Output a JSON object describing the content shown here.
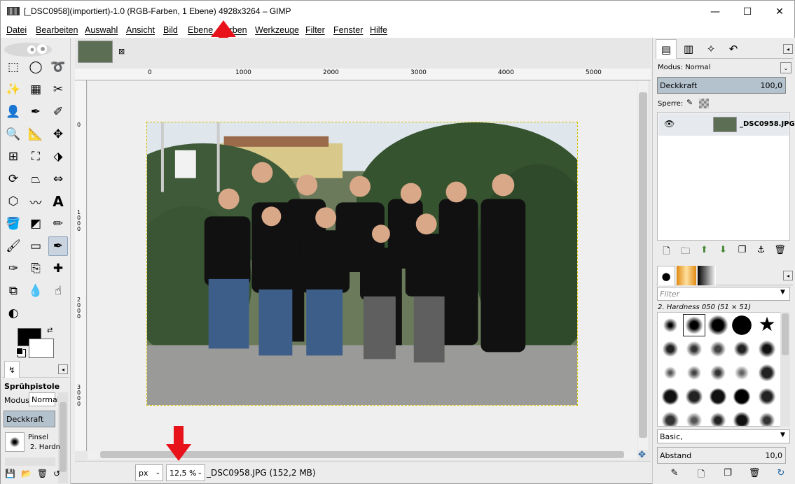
{
  "window": {
    "title": "[_DSC0958](importiert)-1.0 (RGB-Farben, 1 Ebene) 4928x3264 – GIMP",
    "minimize": "—",
    "maximize": "☐",
    "close": "✕"
  },
  "menu": [
    "Datei",
    "Bearbeiten",
    "Auswahl",
    "Ansicht",
    "Bild",
    "Ebene",
    "Farben",
    "Werkzeuge",
    "Filter",
    "Fenster",
    "Hilfe"
  ],
  "toolbox": {
    "tools": [
      "rect-select",
      "ellipse-select",
      "free-select",
      "fuzzy-select",
      "select-by-color",
      "scissors-select",
      "foreground-select",
      "paths",
      "color-picker",
      "zoom",
      "measure",
      "move",
      "align",
      "crop",
      "unified-transform",
      "rotate",
      "perspective",
      "flip",
      "cage-transform",
      "warp-transform",
      "text",
      "bucket-fill",
      "gradient",
      "pencil",
      "paintbrush",
      "eraser",
      "airbrush",
      "ink",
      "clone",
      "heal",
      "perspective-clone",
      "blur",
      "smudge",
      "dodge-burn"
    ],
    "active_tool": "airbrush",
    "fg_color": "#000000",
    "bg_color": "#ffffff",
    "options": {
      "tool_name": "Sprühpistole",
      "mode_label": "Modus:",
      "mode_value": "Normal",
      "opacity_label": "Deckkraft",
      "brush_label": "Pinsel",
      "brush_value": "2. Hardn"
    }
  },
  "canvas": {
    "image_tab_close": "⊠",
    "ruler_labels": [
      "0",
      "1000",
      "2000",
      "3000",
      "4000",
      "5000"
    ],
    "vruler_labels": [
      "0",
      "1000",
      "2000",
      "3000"
    ],
    "unit": "px",
    "zoom": "12,5 %",
    "status_text": "_DSC0958.JPG (152,2 MB)"
  },
  "layers": {
    "mode_label": "Modus: Normal",
    "opacity_label": "Deckkraft",
    "opacity_value": "100,0",
    "lock_label": "Sperre:",
    "layer_name": "_DSC0958.JPG"
  },
  "brushes": {
    "filter_placeholder": "Filter",
    "selected_brush": "2. Hardness 050 (51 × 51)",
    "preset": "Basic,",
    "spacing_label": "Abstand",
    "spacing_value": "10,0"
  },
  "colors": {
    "accent_red": "#e8121b",
    "selection": "#d0c000"
  }
}
